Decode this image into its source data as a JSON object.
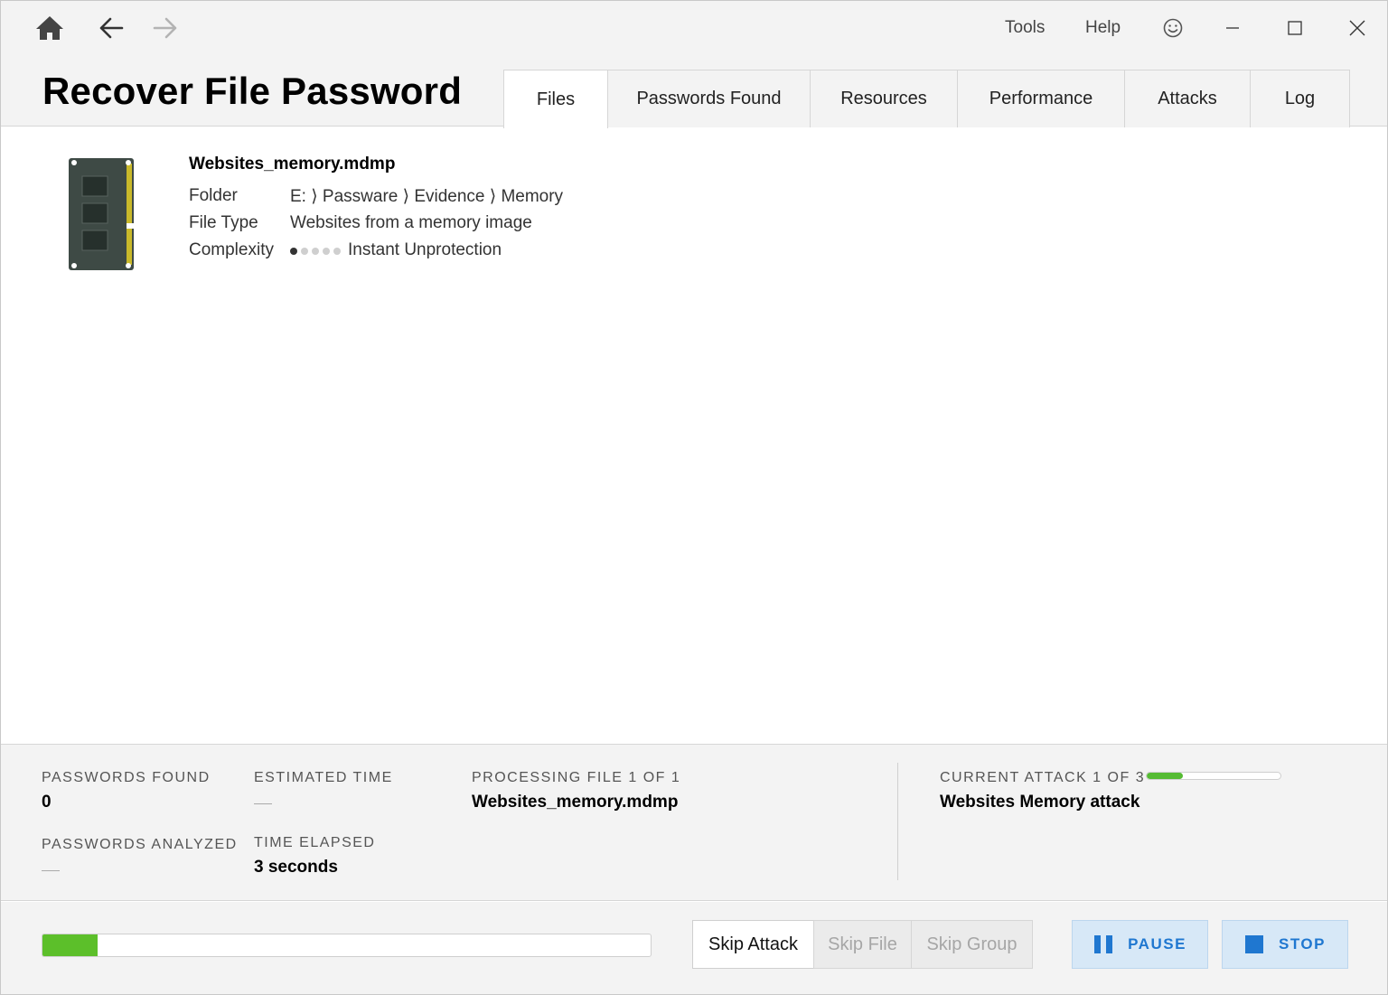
{
  "header": {
    "title": "Recover File Password",
    "menu": {
      "tools": "Tools",
      "help": "Help"
    }
  },
  "icons": {
    "home": "home-icon",
    "back": "arrow-left-icon",
    "forward": "arrow-right-icon",
    "feedback": "smiley-icon",
    "minimize": "minimize-icon",
    "maximize": "maximize-icon",
    "close": "close-icon",
    "file": "memory-module-icon"
  },
  "tabs": [
    {
      "label": "Files",
      "active": true
    },
    {
      "label": "Passwords Found",
      "active": false
    },
    {
      "label": "Resources",
      "active": false
    },
    {
      "label": "Performance",
      "active": false
    },
    {
      "label": "Attacks",
      "active": false
    },
    {
      "label": "Log",
      "active": false
    }
  ],
  "file": {
    "name": "Websites_memory.mdmp",
    "folder_label": "Folder",
    "folder_value": "E: ⟩ Passware ⟩ Evidence ⟩ Memory",
    "type_label": "File Type",
    "type_value": "Websites from a memory image",
    "complexity_label": "Complexity",
    "complexity_value": "Instant Unprotection",
    "complexity_level": 1,
    "complexity_max": 5
  },
  "status": {
    "passwords_found_label": "PASSWORDS FOUND",
    "passwords_found_value": "0",
    "passwords_analyzed_label": "PASSWORDS ANALYZED",
    "estimated_time_label": "ESTIMATED TIME",
    "time_elapsed_label": "TIME ELAPSED",
    "time_elapsed_value": "3 seconds",
    "processing_label": "PROCESSING FILE 1 OF 1",
    "processing_value": "Websites_memory.mdmp",
    "attack_label": "CURRENT ATTACK 1 OF 3",
    "attack_value": "Websites Memory attack",
    "attack_progress": 0.27
  },
  "controls": {
    "overall_progress": 0.09,
    "skip_attack": "Skip Attack",
    "skip_file": "Skip File",
    "skip_group": "Skip Group",
    "pause": "PAUSE",
    "stop": "STOP"
  },
  "colors": {
    "accent": "#1f77d0",
    "progress": "#5cbf2a",
    "action_bg": "#d7e8f7"
  }
}
